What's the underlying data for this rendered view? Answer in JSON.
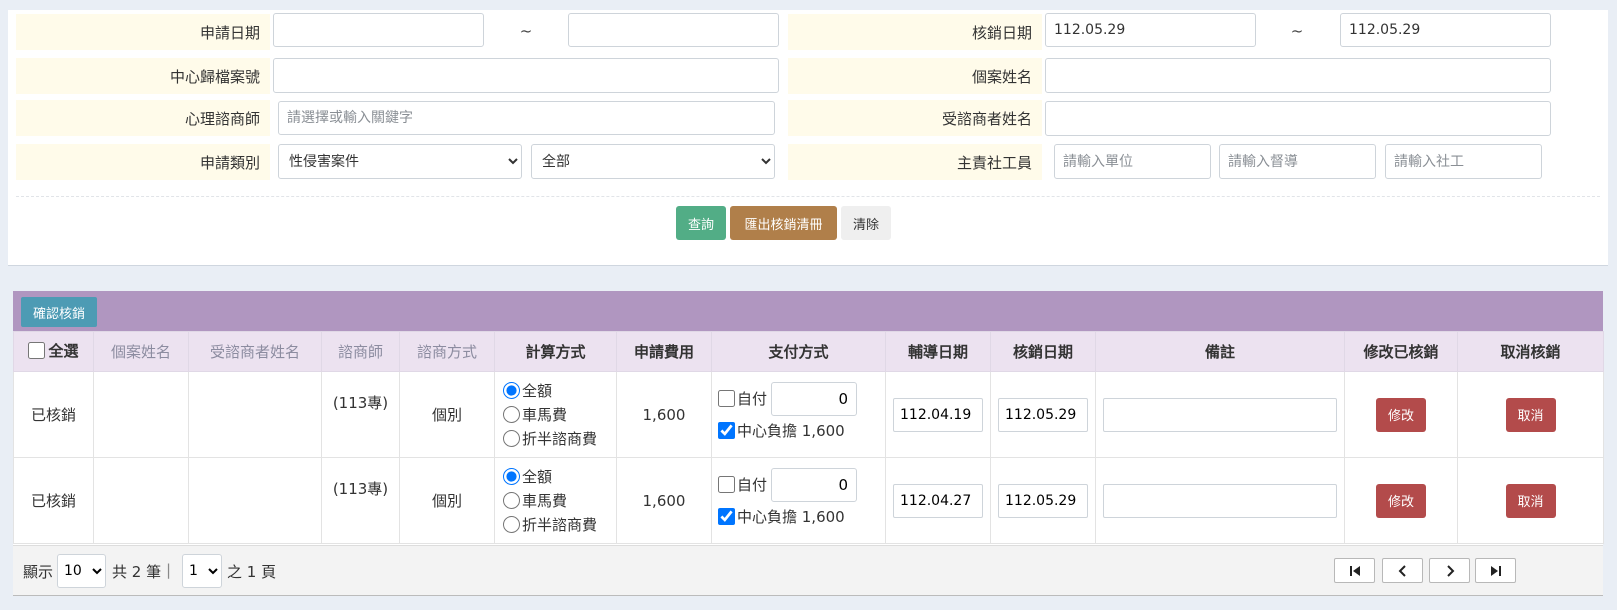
{
  "search": {
    "apply_date": {
      "label": "申請日期",
      "from": "",
      "to": "",
      "separator": "~"
    },
    "writeoff_date": {
      "label": "核銷日期",
      "from": "112.05.29",
      "to": "112.05.29",
      "separator": "~"
    },
    "case_no": {
      "label": "中心歸檔案號",
      "value": ""
    },
    "case_name": {
      "label": "個案姓名",
      "value": ""
    },
    "counselor": {
      "label": "心理諮商師",
      "placeholder": "請選擇或輸入關鍵字"
    },
    "client_name": {
      "label": "受諮商者姓名",
      "value": ""
    },
    "apply_type": {
      "label": "申請類別",
      "selected": "性侵害案件",
      "sub_selected": "全部"
    },
    "social_worker": {
      "label": "主責社工員",
      "unit_placeholder": "請輸入單位",
      "supervisor_placeholder": "請輸入督導",
      "worker_placeholder": "請輸入社工"
    },
    "buttons": {
      "query": "查詢",
      "export": "匯出核銷清冊",
      "clear": "清除"
    }
  },
  "results": {
    "confirm_button": "確認核銷",
    "columns": {
      "select_all": "全選",
      "case_name": "個案姓名",
      "client_name": "受諮商者姓名",
      "counselor": "諮商師",
      "method": "諮商方式",
      "calc": "計算方式",
      "fee": "申請費用",
      "payment": "支付方式",
      "counsel_date": "輔導日期",
      "writeoff_date": "核銷日期",
      "note": "備註",
      "modify": "修改已核銷",
      "cancel": "取消核銷"
    },
    "calc_options": [
      "全額",
      "車馬費",
      "折半諮商費"
    ],
    "payment_self_label": "自付",
    "payment_center_label": "中心負擔 1,600",
    "modify_button": "修改",
    "cancel_button": "取消",
    "rows": [
      {
        "status": "已核銷",
        "case_name": "",
        "client_name": "",
        "counselor": "(113專)",
        "method": "個別",
        "calc_selected": "全額",
        "fee": "1,600",
        "self_pay": "0",
        "self_checked": false,
        "center_checked": true,
        "counsel_date": "112.04.19",
        "writeoff_date": "112.05.29",
        "note": ""
      },
      {
        "status": "已核銷",
        "case_name": "",
        "client_name": "",
        "counselor": "(113專)",
        "method": "個別",
        "calc_selected": "全額",
        "fee": "1,600",
        "self_pay": "0",
        "self_checked": false,
        "center_checked": true,
        "counsel_date": "112.04.27",
        "writeoff_date": "112.05.29",
        "note": ""
      }
    ]
  },
  "pager": {
    "show_label": "顯示",
    "page_size": "10",
    "total_text": "共 2 筆",
    "sep": "|",
    "current_page": "1",
    "pages_text": "之 1 頁"
  }
}
